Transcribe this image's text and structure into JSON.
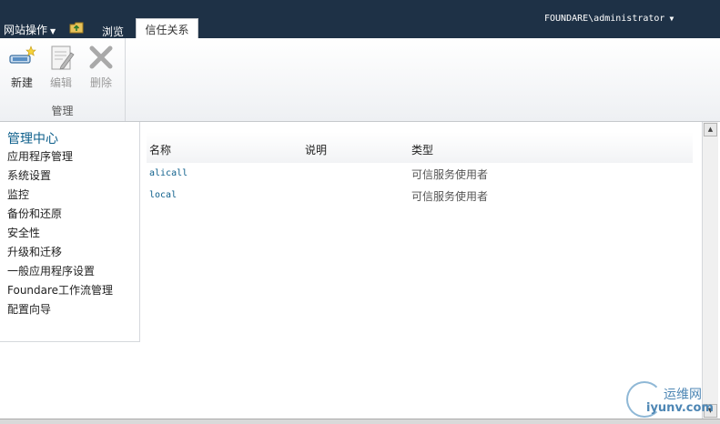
{
  "topbar": {
    "site_actions": "网站操作",
    "tab_browse": "浏览",
    "tab_trust": "信任关系",
    "user": "FOUNDARE\\administrator"
  },
  "ribbon": {
    "buttons": {
      "new": "新建",
      "edit": "编辑",
      "delete": "删除"
    },
    "group_label": "管理"
  },
  "leftnav": {
    "title": "管理中心",
    "items": [
      "应用程序管理",
      "系统设置",
      "监控",
      "备份和还原",
      "安全性",
      "升级和迁移",
      "一般应用程序设置",
      "Foundare工作流管理",
      "配置向导"
    ]
  },
  "list": {
    "columns": [
      "名称",
      "说明",
      "类型"
    ],
    "rows": [
      {
        "name": "alicall",
        "description": "",
        "type": "可信服务使用者"
      },
      {
        "name": "local",
        "description": "",
        "type": "可信服务使用者"
      }
    ]
  },
  "watermark": {
    "cn": "运维网",
    "en": "iyunv.com"
  }
}
